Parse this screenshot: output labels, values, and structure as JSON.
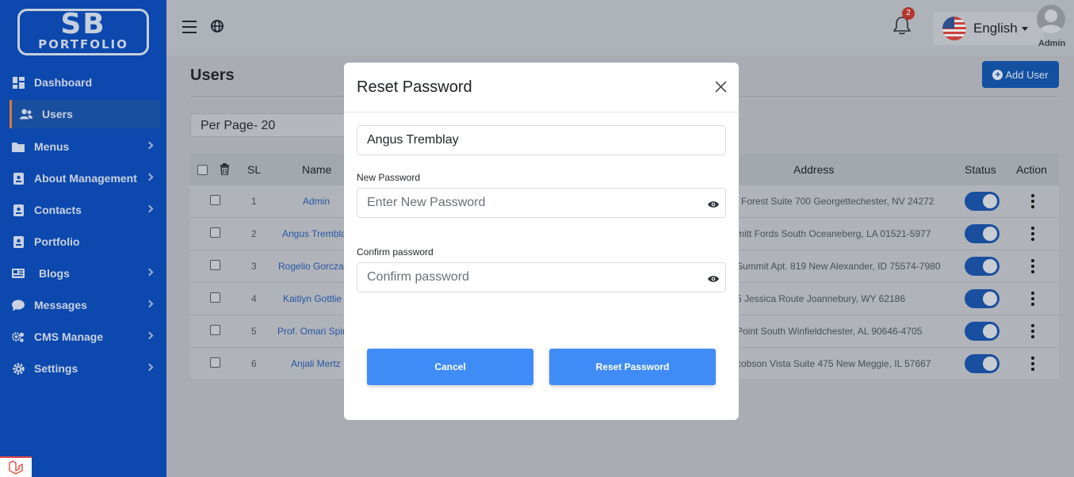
{
  "logo": {
    "line1": "SB",
    "line2": "PORTFOLIO"
  },
  "sidebar": {
    "items": [
      {
        "label": "Dashboard",
        "icon": "dashboard-icon"
      },
      {
        "label": "Users",
        "icon": "users-icon"
      },
      {
        "label": "Menus",
        "icon": "folder-icon"
      },
      {
        "label": "About Management",
        "icon": "id-card-icon"
      },
      {
        "label": "Contacts",
        "icon": "contact-icon"
      },
      {
        "label": "Portfolio",
        "icon": "portfolio-icon"
      },
      {
        "label": "Blogs",
        "icon": "blog-icon"
      },
      {
        "label": "Messages",
        "icon": "chat-icon"
      },
      {
        "label": "CMS Manage",
        "icon": "cogs-icon"
      },
      {
        "label": "Settings",
        "icon": "gear-icon"
      }
    ]
  },
  "topbar": {
    "notification_count": "2",
    "language": "English",
    "user_label": "Admin"
  },
  "main": {
    "title": "Users",
    "add_user_label": "Add User",
    "per_page": "Per Page- 20",
    "table": {
      "headers": {
        "sl": "SL",
        "name": "Name",
        "address": "Address",
        "status": "Status",
        "action": "Action"
      },
      "rows": [
        {
          "sl": "1",
          "name": "Admin",
          "address": "l Forest Suite 700 Georgettechester, NV 24272"
        },
        {
          "sl": "2",
          "name": "Angus Trembla",
          "address": "mitt Fords South Oceaneberg, LA 01521-5977"
        },
        {
          "sl": "3",
          "name": "Rogelio Gorcza",
          "address": "Summit Apt. 819 New Alexander, ID 75574-7980"
        },
        {
          "sl": "4",
          "name": "Kaitlyn Gottlie",
          "address": "5 Jessica Route Joannebury, WY 62186"
        },
        {
          "sl": "5",
          "name": "Prof. Omari Spir",
          "address": "Point South Winfieldchester, AL 90646-4705"
        },
        {
          "sl": "6",
          "name": "Anjali Mertz",
          "address": "cobson Vista Suite 475 New Meggie, IL 57667"
        }
      ]
    }
  },
  "modal": {
    "title": "Reset Password",
    "user_value": "Angus Tremblay",
    "new_password_label": "New Password",
    "new_password_placeholder": "Enter New Password",
    "confirm_label": "Confirm password",
    "confirm_placeholder": "Confirm password",
    "cancel_label": "Cancel",
    "submit_label": "Reset Password"
  },
  "colors": {
    "sidebar_bg": "#0c48ad",
    "primary_button": "#3f8cf6",
    "toggle_on": "#1a4e9e",
    "notification_badge": "#b3352e"
  }
}
